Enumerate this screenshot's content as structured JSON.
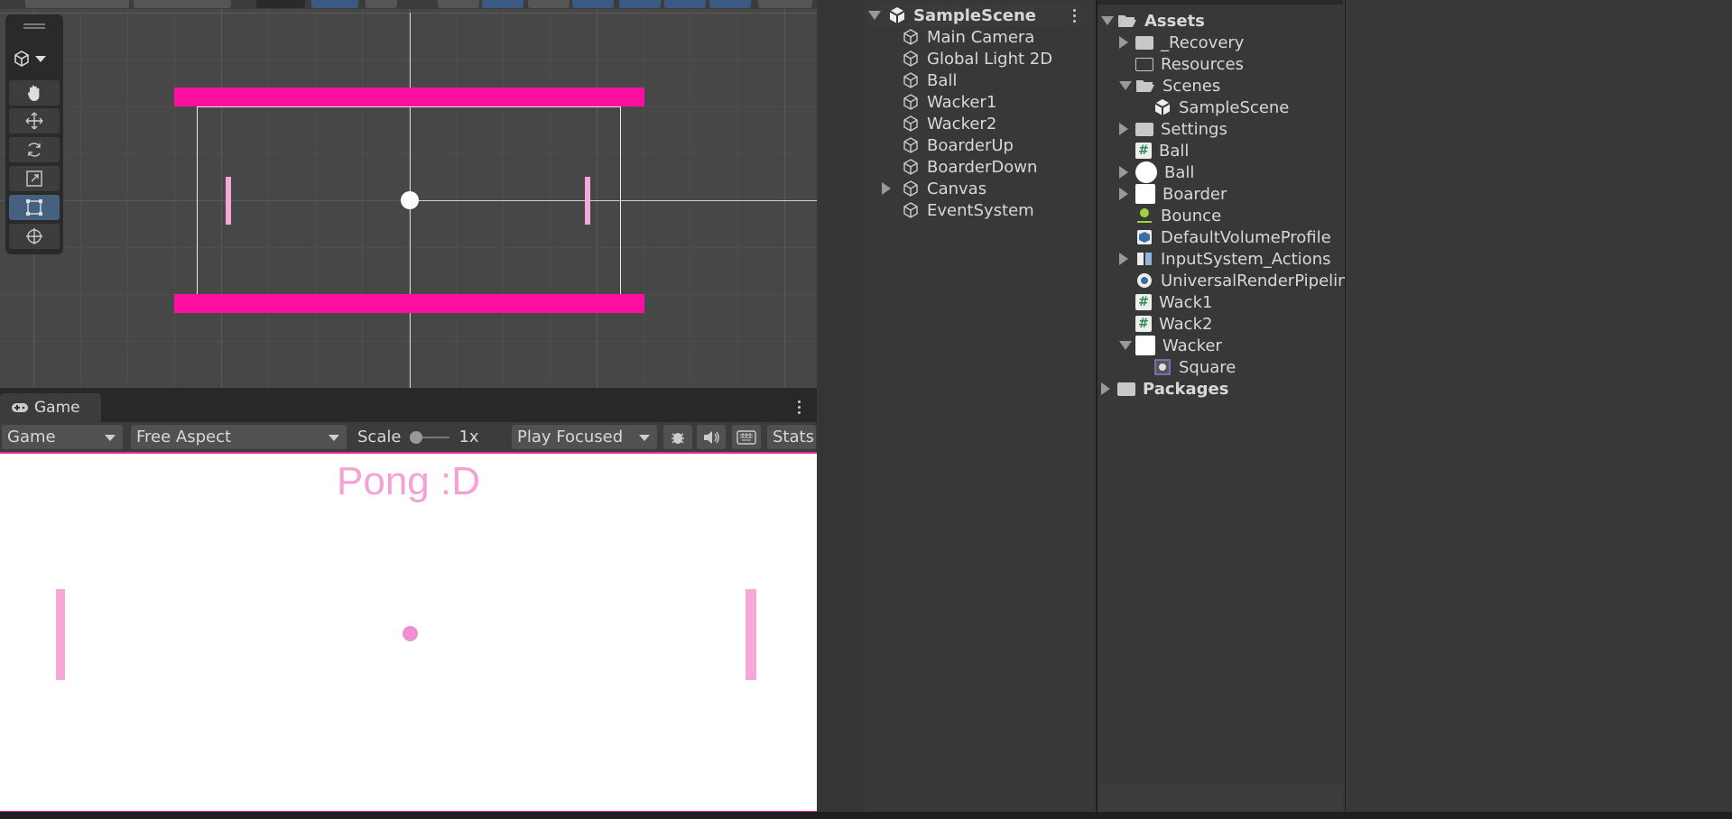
{
  "scene_view": {},
  "game": {
    "tab_label": "Game",
    "display_select": "Game",
    "aspect_select": "Free Aspect",
    "scale_label": "Scale",
    "scale_value": "1x",
    "play_mode_select": "Play Focused",
    "stats_label": "Stats",
    "title_text": "Pong :D"
  },
  "hierarchy": {
    "scene_name": "SampleScene",
    "items": [
      "Main Camera",
      "Global Light 2D",
      "Ball",
      "Wacker1",
      "Wacker2",
      "BoarderUp",
      "BoarderDown",
      "Canvas",
      "EventSystem"
    ]
  },
  "project": {
    "root": "Assets",
    "items": [
      "_Recovery",
      "Resources",
      "Scenes",
      "SampleScene",
      "Settings",
      "Ball",
      "Ball",
      "Boarder",
      "Bounce",
      "DefaultVolumeProfile",
      "InputSystem_Actions",
      "UniversalRenderPipeline",
      "Wack1",
      "Wack2",
      "Wacker",
      "Square"
    ],
    "packages": "Packages"
  },
  "colors": {
    "accent_pink": "#ff0fa0",
    "game_pink": "#f7a0d6",
    "active_tool": "#46607f"
  }
}
